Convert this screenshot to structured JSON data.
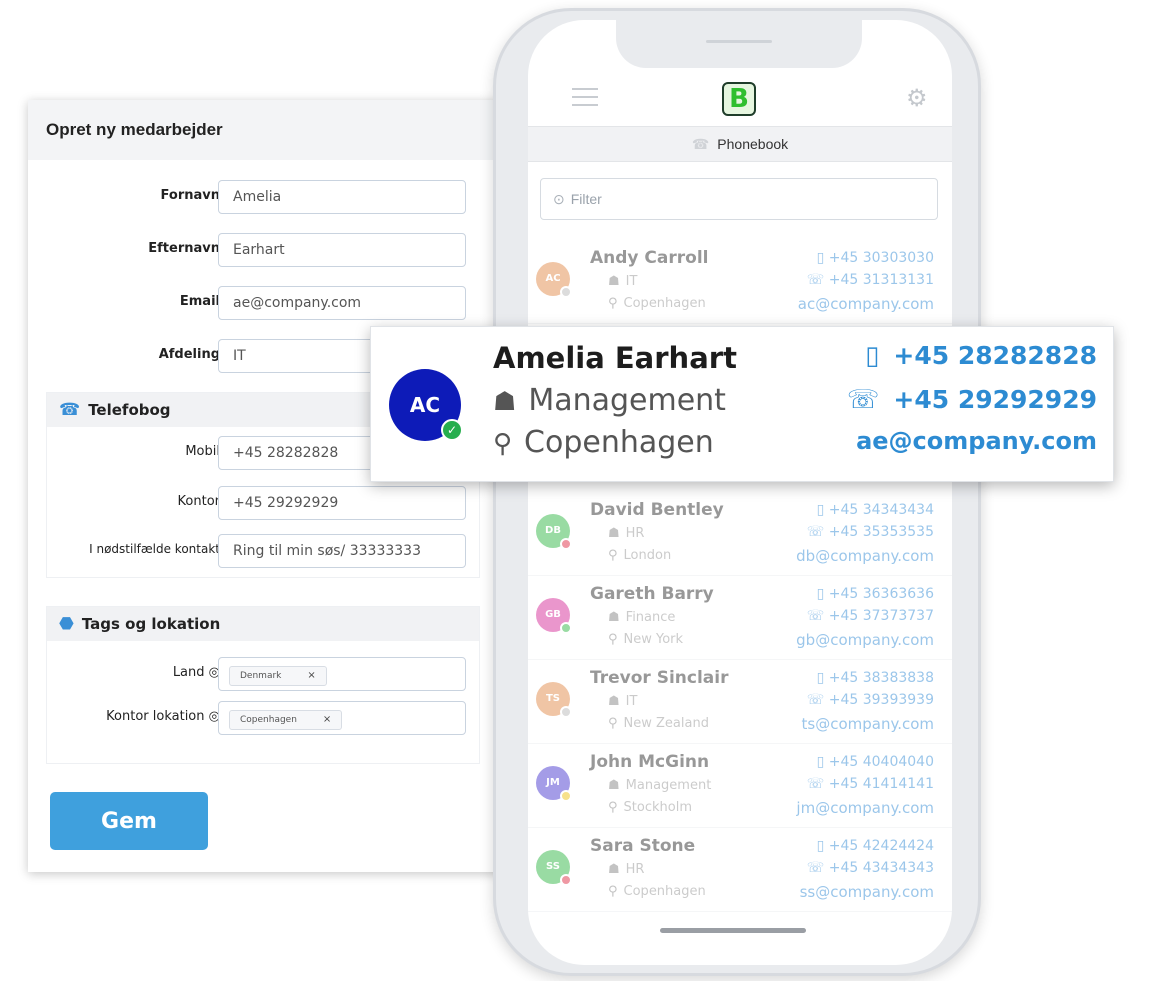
{
  "form": {
    "title": "Opret ny medarbejder",
    "fields": {
      "firstname": {
        "label": "Fornavn",
        "value": "Amelia"
      },
      "lastname": {
        "label": "Efternavn",
        "value": "Earhart"
      },
      "email": {
        "label": "Email",
        "value": "ae@company.com"
      },
      "department": {
        "label": "Afdeling",
        "value": "IT"
      }
    },
    "phone_section": {
      "title": "Telefobog",
      "mobile": {
        "label": "Mobil",
        "value": "+45 28282828"
      },
      "office": {
        "label": "Kontor",
        "value": "+45 29292929"
      },
      "emergency": {
        "label": "I nødstilfælde kontakt",
        "value": "Ring til min søs/ 33333333"
      }
    },
    "tags_section": {
      "title": "Tags og lokation",
      "country": {
        "label": "Land",
        "tag": "Denmark"
      },
      "office_location": {
        "label": "Kontor lokation",
        "tag": "Copenhagen"
      },
      "remove_glyph": "×"
    },
    "save_label": "Gem"
  },
  "phone": {
    "header_title": "Phonebook",
    "filter_placeholder": "Filter",
    "contacts": [
      {
        "initials": "AC",
        "name": "Andy Carroll",
        "department": "IT",
        "location": "Copenhagen",
        "mobile": "+45 30303030",
        "office": "+45 31313131",
        "email": "ac@company.com",
        "avatar_color": "#e38c4e",
        "status_color": "#bbbbbb"
      },
      {
        "initials": "DB",
        "name": "David Bentley",
        "department": "HR",
        "location": "London",
        "mobile": "+45 34343434",
        "office": "+45 35353535",
        "email": "db@company.com",
        "avatar_color": "#35b84a",
        "status_color": "#e0334a"
      },
      {
        "initials": "GB",
        "name": "Gareth Barry",
        "department": "Finance",
        "location": "New York",
        "mobile": "+45 36363636",
        "office": "+45 37373737",
        "email": "gb@company.com",
        "avatar_color": "#d6309a",
        "status_color": "#35b84a"
      },
      {
        "initials": "TS",
        "name": "Trevor Sinclair",
        "department": "IT",
        "location": "New Zealand",
        "mobile": "+45 38383838",
        "office": "+45 39393939",
        "email": "ts@company.com",
        "avatar_color": "#e38c4e",
        "status_color": "#bbbbbb"
      },
      {
        "initials": "JM",
        "name": "John McGinn",
        "department": "Management",
        "location": "Stockholm",
        "mobile": "+45 40404040",
        "office": "+45 41414141",
        "email": "jm@company.com",
        "avatar_color": "#4b3bd1",
        "status_color": "#f0c419"
      },
      {
        "initials": "SS",
        "name": "Sara Stone",
        "department": "HR",
        "location": "Copenhagen",
        "mobile": "+45 42424424",
        "office": "+45 43434343",
        "email": "ss@company.com",
        "avatar_color": "#35b84a",
        "status_color": "#e0334a"
      }
    ]
  },
  "highlight": {
    "initials": "AC",
    "name": "Amelia Earhart",
    "department": "Management",
    "location": "Copenhagen",
    "mobile": "+45 28282828",
    "office": "+45 29292929",
    "email": "ae@company.com",
    "avatar_color": "#0d1bb8",
    "status_color": "#27ae4e"
  },
  "icons": {
    "phone_receiver": "☎",
    "mobile": "▯",
    "office_phone": "☏",
    "department": "☗",
    "location": "⚲",
    "check": "✓",
    "tag": "⬣",
    "search": "⊙",
    "settings": "⚙",
    "location_pin": "◎"
  },
  "colors": {
    "accent": "#3a8fd6",
    "save_button": "#3fa0dd"
  }
}
